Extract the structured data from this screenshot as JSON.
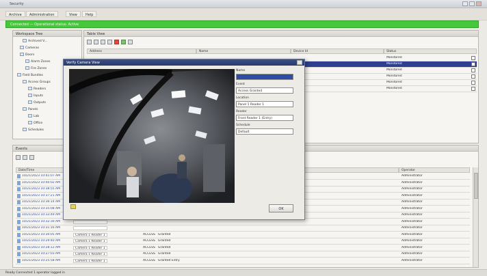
{
  "window": {
    "title": "Security",
    "min": "",
    "max": "",
    "close": ""
  },
  "menu": [
    "Archive",
    "Administration",
    "View",
    "Help"
  ],
  "banner": "Connected — Operational status: Active",
  "left_panel": {
    "header": "Workspace Tree",
    "items": [
      {
        "label": "Archived V...",
        "indent": 14
      },
      {
        "label": "Cameras",
        "indent": 10
      },
      {
        "label": "Doors",
        "indent": 10
      },
      {
        "label": "Alarm Zones",
        "indent": 18
      },
      {
        "label": "Fire Zones",
        "indent": 18
      },
      {
        "label": "Field Bundles",
        "indent": 6
      },
      {
        "label": "Access Groups",
        "indent": 14
      },
      {
        "label": "Readers",
        "indent": 22
      },
      {
        "label": "Inputs",
        "indent": 22
      },
      {
        "label": "Outputs",
        "indent": 22
      },
      {
        "label": "Panels",
        "indent": 14
      },
      {
        "label": "Lab",
        "indent": 22
      },
      {
        "label": "Office",
        "indent": 22
      },
      {
        "label": "Schedules",
        "indent": 14
      }
    ]
  },
  "table_panel": {
    "header": "Table View",
    "columns": [
      "Address",
      "Name",
      "Device Id",
      "Status"
    ],
    "rows": [
      {
        "status": "Monitored",
        "selected": false
      },
      {
        "status": "Monitored",
        "selected": true
      },
      {
        "status": "Monitored",
        "selected": false
      },
      {
        "status": "Monitored",
        "selected": false
      },
      {
        "status": "Monitored",
        "selected": false
      },
      {
        "status": "Monitored",
        "selected": false
      }
    ]
  },
  "events_panel": {
    "header": "Events",
    "columns": [
      "Date/Time",
      "Operator"
    ],
    "rows": [
      {
        "datetime": "10/21/2023 10:41:07 AM",
        "source": "",
        "type": "",
        "desc": "",
        "operator": "Administrator"
      },
      {
        "datetime": "10/21/2023 10:40:02 AM",
        "source": "",
        "type": "",
        "desc": "",
        "operator": "Administrator"
      },
      {
        "datetime": "10/21/2023 10:38:55 AM",
        "source": "",
        "type": "",
        "desc": "",
        "operator": "Administrator"
      },
      {
        "datetime": "10/21/2023 10:37:21 AM",
        "source": "",
        "type": "",
        "desc": "",
        "operator": "Administrator"
      },
      {
        "datetime": "10/21/2023 10:36:14 AM",
        "source": "",
        "type": "",
        "desc": "",
        "operator": "Administrator"
      },
      {
        "datetime": "10/21/2023 10:35:08 AM",
        "source": "",
        "type": "",
        "desc": "",
        "operator": "Administrator"
      },
      {
        "datetime": "10/21/2023 10:33:49 AM",
        "source": "",
        "type": "",
        "desc": "",
        "operator": "Administrator"
      },
      {
        "datetime": "10/21/2023 10:32:30 AM",
        "source": "",
        "type": "",
        "desc": "",
        "operator": "Administrator"
      },
      {
        "datetime": "10/21/2023 10:31:16 AM",
        "source": "",
        "type": "",
        "desc": "",
        "operator": "Administrator"
      },
      {
        "datetime": "10/21/2023 10:30:05 AM",
        "source": "Camera 1 Reader 1",
        "type": "ACCESS",
        "desc": "Granted",
        "operator": "Administrator"
      },
      {
        "datetime": "10/21/2023 10:29:40 AM",
        "source": "Camera 1 Reader 1",
        "type": "ACCESS",
        "desc": "Granted",
        "operator": "Administrator"
      },
      {
        "datetime": "10/21/2023 10:28:12 AM",
        "source": "Camera 1 Reader 1",
        "type": "ACCESS",
        "desc": "Granted",
        "operator": "Administrator"
      },
      {
        "datetime": "10/21/2023 10:27:03 AM",
        "source": "Camera 1 Reader 1",
        "type": "ACCESS",
        "desc": "Granted",
        "operator": "Administrator"
      },
      {
        "datetime": "10/21/2023 10:25:58 AM",
        "source": "Camera 1 Reader 1",
        "type": "ACCESS",
        "desc": "Granted Entry",
        "operator": "Administrator"
      }
    ]
  },
  "dialog": {
    "title": "Verify Camera View",
    "fields": [
      {
        "label": "Name",
        "value": "",
        "highlight": true
      },
      {
        "label": "Event",
        "value": "Access Granted"
      },
      {
        "label": "Location",
        "value": "Panel 1 Reader 1"
      },
      {
        "label": "Reader",
        "value": "Front Reader 1 (Entry)"
      },
      {
        "label": "Schedule",
        "value": "Default"
      }
    ],
    "ok_label": "OK"
  },
  "status_bar": "Ready   Connected   1 operator logged in"
}
